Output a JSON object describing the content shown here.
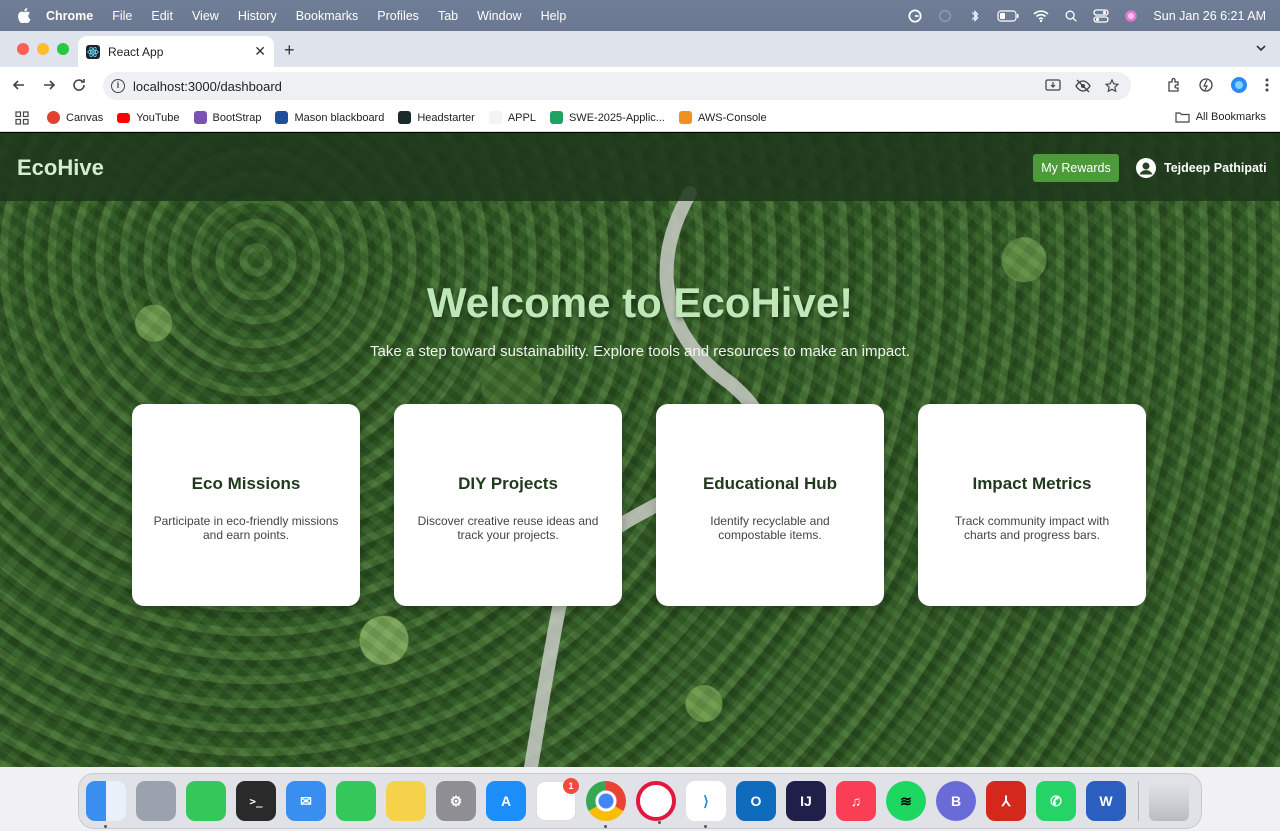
{
  "menubar": {
    "app_name": "Chrome",
    "items": [
      "File",
      "Edit",
      "View",
      "History",
      "Bookmarks",
      "Profiles",
      "Tab",
      "Window",
      "Help"
    ],
    "datetime": "Sun Jan 26  6:21 AM"
  },
  "browser": {
    "tab_title": "React App",
    "url": "localhost:3000/dashboard",
    "bookmarks": [
      {
        "label": "Canvas",
        "icon": "canvas-icon",
        "color": "#e2412f"
      },
      {
        "label": "YouTube",
        "icon": "youtube-icon",
        "color": "#ff0000"
      },
      {
        "label": "BootStrap",
        "icon": "bootstrap-icon",
        "color": "#7952b3"
      },
      {
        "label": "Mason blackboard",
        "icon": "blackboard-icon",
        "color": "#1f4e9c"
      },
      {
        "label": "Headstarter",
        "icon": "headstarter-icon",
        "color": "#1b2b2a"
      },
      {
        "label": "APPL",
        "icon": "apple-icon",
        "color": "#cccccc"
      },
      {
        "label": "SWE-2025-Applic...",
        "icon": "sheets-icon",
        "color": "#1ea362"
      },
      {
        "label": "AWS-Console",
        "icon": "aws-icon",
        "color": "#ef8f1f"
      }
    ],
    "all_bookmarks": "All Bookmarks"
  },
  "app": {
    "brand": "EcoHive",
    "rewards_button": "My Rewards",
    "user_name": "Tejdeep Pathipati",
    "hero_title": "Welcome to EcoHive!",
    "hero_subtitle": "Take a step toward sustainability. Explore tools and resources to make an impact.",
    "cards": [
      {
        "title": "Eco Missions",
        "desc": "Participate in eco-friendly missions and earn points."
      },
      {
        "title": "DIY Projects",
        "desc": "Discover creative reuse ideas and track your projects."
      },
      {
        "title": "Educational Hub",
        "desc": "Identify recyclable and compostable items."
      },
      {
        "title": "Impact Metrics",
        "desc": "Track community impact with charts and progress bars."
      }
    ]
  },
  "dock": {
    "apps": [
      {
        "name": "finder-icon",
        "color": "#3a8ef0"
      },
      {
        "name": "launchpad-icon",
        "color": "#9aa2ad"
      },
      {
        "name": "messages-icon",
        "color": "#34c759"
      },
      {
        "name": "terminal-icon",
        "color": "#2a2a2a"
      },
      {
        "name": "mail-icon",
        "color": "#3a8ef0"
      },
      {
        "name": "facetime-icon",
        "color": "#34c759"
      },
      {
        "name": "notes-icon",
        "color": "#f6d24a"
      },
      {
        "name": "system-settings-icon",
        "color": "#8e8e93"
      },
      {
        "name": "app-store-icon",
        "color": "#1c8ef9"
      },
      {
        "name": "reminders-icon",
        "color": "#ffffff"
      },
      {
        "name": "chrome-icon",
        "color": "#ffffff"
      },
      {
        "name": "opera-icon",
        "color": "#ffffff"
      },
      {
        "name": "vscode-icon",
        "color": "#ffffff"
      },
      {
        "name": "outlook-icon",
        "color": "#0f6cbd"
      },
      {
        "name": "intellij-icon",
        "color": "#1f1f4a"
      },
      {
        "name": "music-icon",
        "color": "#fa3e55"
      },
      {
        "name": "spotify-icon",
        "color": "#1ed760"
      },
      {
        "name": "bbedit-icon",
        "color": "#6b6bd8"
      },
      {
        "name": "acrobat-icon",
        "color": "#d4281c"
      },
      {
        "name": "whatsapp-icon",
        "color": "#25d366"
      },
      {
        "name": "word-icon",
        "color": "#2b5fbf"
      }
    ],
    "reminders_badge": "1"
  }
}
